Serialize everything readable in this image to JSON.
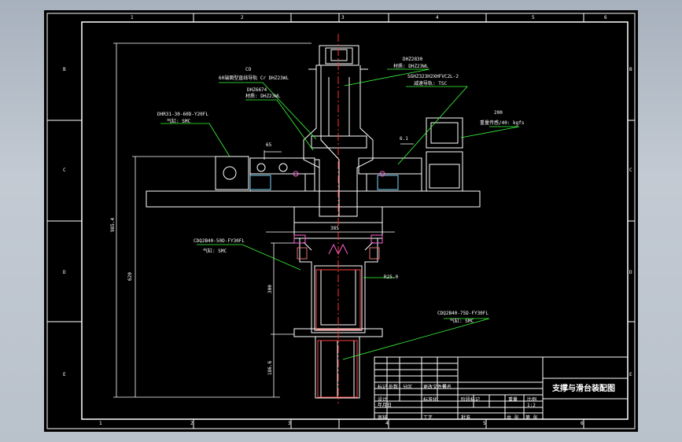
{
  "title": "支撑与滑台装配图",
  "zones": {
    "top": [
      "1",
      "2",
      "3",
      "4",
      "5",
      "6"
    ],
    "bottom": [
      "1",
      "2",
      "3",
      "4",
      "5",
      "6"
    ],
    "left": [
      "B",
      "C",
      "D",
      "E"
    ],
    "right": [
      "B",
      "C",
      "D",
      "E"
    ]
  },
  "callouts": {
    "c1a": "CO",
    "c1b": "60端面型直线导轨 Cr DHZ23WL",
    "c2a": "DHZ6674",
    "c2b": "材质: DHZ23WL",
    "c3a": "DHZ2830",
    "c3b": "材质: DHZ23WL",
    "c4a": "SGHZ323H2XHFVC2L-2",
    "c4b": "减速导轨: TSC",
    "c5a": "DHR31-30-60D-Y20FL",
    "c5b": "气缸: SMC",
    "c6a": "200",
    "c6b": "重量传感/40: kgfs",
    "c7a": "CDQ2B40-50D-FY30FL",
    "c7b": "气缸: SMC",
    "c8a": "CDQ2B40-75D-FY30FL",
    "c8b": "气缸: SMC"
  },
  "dims": {
    "overall_height": "985.4",
    "height_mid": "620",
    "height_lower": "300",
    "height_bottom": "186.6",
    "d_65": "65",
    "d_gap": "6.1",
    "width_385": "385",
    "d_bore": "R25.0"
  },
  "titleblock": {
    "cells": [
      "标记",
      "处数",
      "分区",
      "更改文件号",
      "签名",
      "年月日",
      "设计",
      "标准化",
      "阶段标记",
      "重量",
      "比例",
      "审核",
      "工艺",
      "批准",
      "共 张",
      "第 张"
    ],
    "scale": "1:2"
  }
}
